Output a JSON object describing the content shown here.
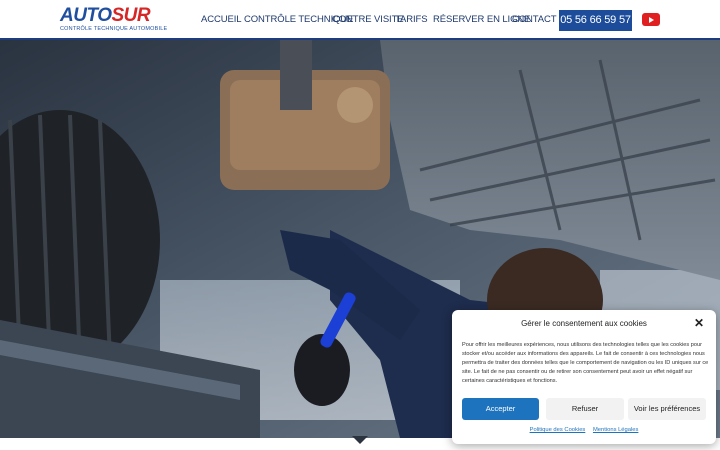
{
  "header": {
    "logo": {
      "brand_a": "AUTO",
      "brand_b": "SUR",
      "tagline": "CONTRÔLE TECHNIQUE AUTOMOBILE"
    },
    "nav": [
      {
        "label": "ACCUEIL"
      },
      {
        "label": "CONTRÔLE TECHNIQUE"
      },
      {
        "label": "CONTRE VISITE"
      },
      {
        "label": "TARIFS"
      },
      {
        "label": "RÉSERVER EN LIGNE"
      },
      {
        "label": "CONTACT"
      }
    ],
    "phone": "05 56 66 59 57",
    "social_icon": "youtube-icon",
    "colors": {
      "brand_blue": "#1f4f9e",
      "brand_red": "#d62626",
      "phone_bg": "#1d4d9a"
    }
  },
  "hero": {
    "image_alt_icon": "hero-photo"
  },
  "consent": {
    "title": "Gérer le consentement aux cookies",
    "body": "Pour offrir les meilleures expériences, nous utilisons des technologies telles que les cookies pour stocker et/ou accéder aux informations des appareils. Le fait de consentir à ces technologies nous permettra de traiter des données telles que le comportement de navigation ou les ID uniques sur ce site. Le fait de ne pas consentir ou de retirer son consentement peut avoir un effet négatif sur certaines caractéristiques et fonctions.",
    "accept_label": "Accepter",
    "refuse_label": "Refuser",
    "prefs_label": "Voir les préférences",
    "links": [
      {
        "label": "Politique des Cookies"
      },
      {
        "label": "Mentions Légales"
      }
    ],
    "colors": {
      "accept_bg": "#1e73be"
    }
  }
}
